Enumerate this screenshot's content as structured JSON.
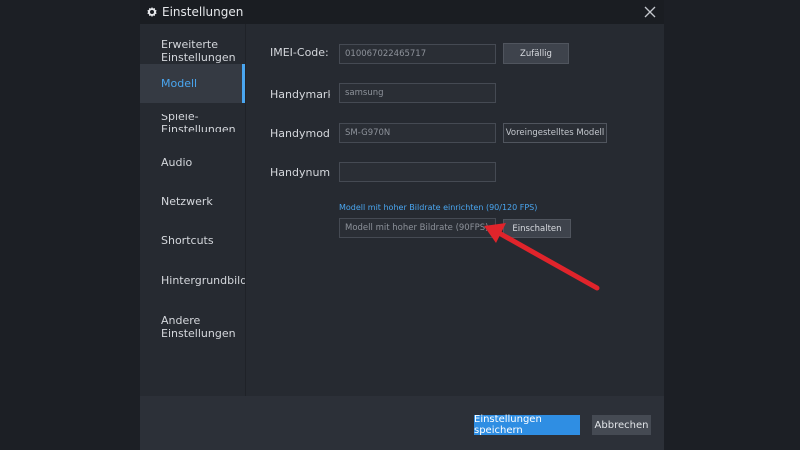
{
  "window": {
    "title": "Einstellungen"
  },
  "sidebar": {
    "items": [
      {
        "label": "Erweiterte\nEinstellungen"
      },
      {
        "label": "Modell"
      },
      {
        "label": "Spiele-Einstellungen"
      },
      {
        "label": "Audio"
      },
      {
        "label": "Netzwerk"
      },
      {
        "label": "Shortcuts"
      },
      {
        "label": "Hintergrundbild"
      },
      {
        "label": "Andere\nEinstellungen"
      }
    ],
    "active_index": 1
  },
  "model": {
    "imei_label": "IMEI-Code:",
    "imei_value": "010067022465717",
    "random_button": "Zufällig",
    "brand_label": "Handymarke:",
    "brand_value": "samsung",
    "model_label": "Handymodell:",
    "model_value": "SM-G970N",
    "preset_button": "Voreingestelltes Modell",
    "number_label": "Handynummer:",
    "number_value": "",
    "high_fps_link": "Modell mit hoher Bildrate einrichten (90/120 FPS)",
    "high_fps_value": "Modell mit hoher Bildrate (90FPS)",
    "enable_button": "Einschalten"
  },
  "footer": {
    "save_button": "Einstellungen speichern",
    "cancel_button": "Abbrechen"
  },
  "colors": {
    "accent": "#4aa6f0",
    "primary_button": "#2f8ee3",
    "annotation_arrow": "#e0242b"
  }
}
